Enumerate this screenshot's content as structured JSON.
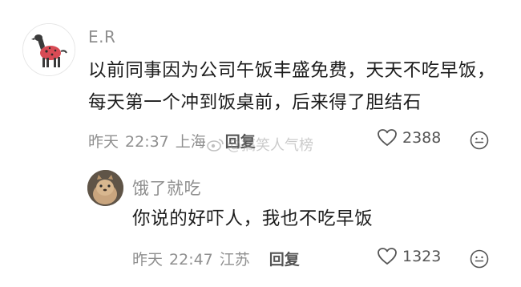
{
  "comments": [
    {
      "username": "E.R",
      "text": "以前同事因为公司午饭丰盛免费，天天不吃早饭，每天第一个冲到饭桌前，后来得了胆结石",
      "date": "昨天",
      "time": "22:37",
      "location": "上海",
      "reply_label": "回复",
      "likes": "2388"
    },
    {
      "username": "饿了就吃",
      "text": "你说的好吓人，我也不吃早饭",
      "date": "昨天",
      "time": "22:47",
      "location": "江苏",
      "reply_label": "回复",
      "likes": "1323"
    }
  ],
  "watermark": "@搞笑人气榜",
  "icons": {
    "like": "heart-outline-icon",
    "emoji": "smile-face-icon"
  }
}
